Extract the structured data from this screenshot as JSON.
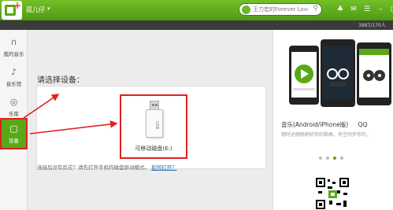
{
  "titlebar": {
    "username": "孤儿仔",
    "search_placeholder": "王力宏的Forever Love",
    "icons": [
      "shirt-icon",
      "message-icon",
      "menu-icon",
      "minimize-icon",
      "maximize-icon",
      "close-icon"
    ]
  },
  "status": {
    "storage": "3887/170人"
  },
  "sidebar": {
    "items": [
      {
        "label": "我的音乐",
        "icon": "headphones-icon"
      },
      {
        "label": "音乐馆",
        "icon": "music-note-icon"
      },
      {
        "label": "乐库",
        "icon": "disc-icon"
      },
      {
        "label": "设备",
        "icon": "device-icon",
        "active": true
      }
    ]
  },
  "main": {
    "choose_label": "请选择设备：",
    "device_name": "可移动磁盘(E:)",
    "help_text": "连接后没有反应？请先打开手机的磁盘驱动模式。",
    "help_link": "如何打开？"
  },
  "promo": {
    "title": "音乐(Android/iPhone版)",
    "title_extra": "QQ",
    "subtitle": "随时达随随地听你的歌曲，有空同步你的"
  },
  "colors": {
    "accent": "#5aa817",
    "highlight": "#e02020"
  }
}
